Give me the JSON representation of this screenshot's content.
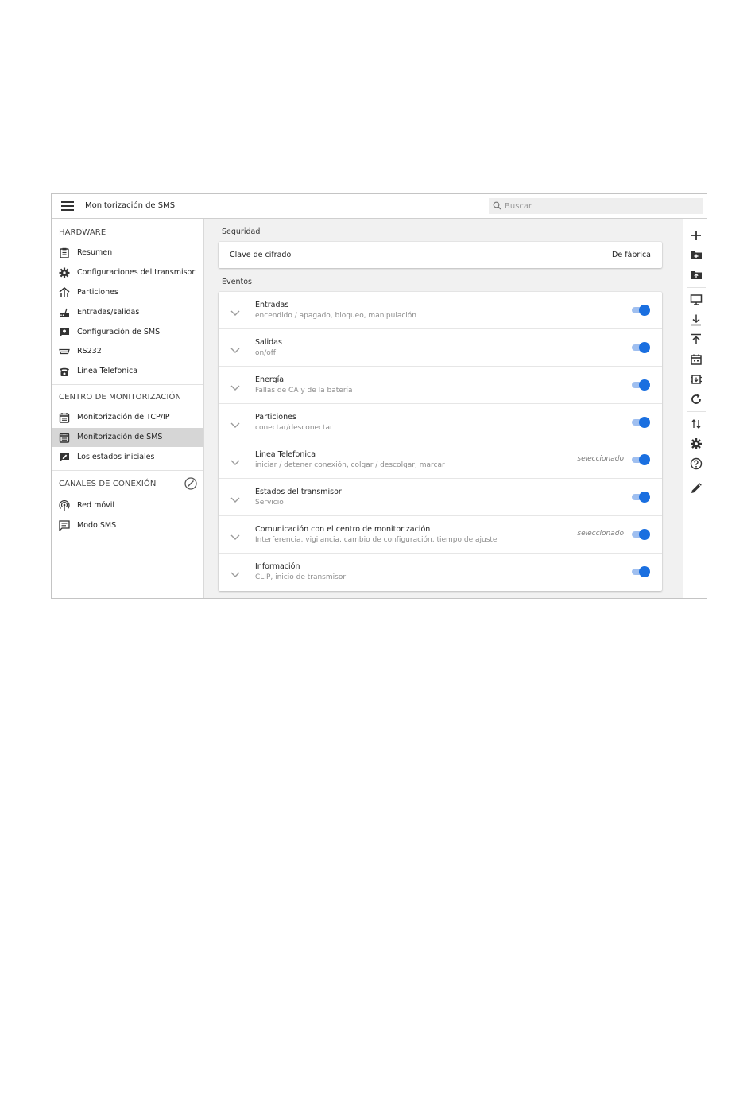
{
  "header": {
    "title": "Monitorización de SMS",
    "search_placeholder": "Buscar"
  },
  "sidebar": {
    "sections": [
      {
        "title": "HARDWARE",
        "items": [
          {
            "label": "Resumen",
            "icon": "clipboard-icon"
          },
          {
            "label": "Configuraciones del transmisor",
            "icon": "gear-icon"
          },
          {
            "label": "Particiones",
            "icon": "partitions-icon"
          },
          {
            "label": "Entradas/salidas",
            "icon": "io-device-icon"
          },
          {
            "label": "Configuración de SMS",
            "icon": "sms-config-icon"
          },
          {
            "label": "RS232",
            "icon": "serial-port-icon"
          },
          {
            "label": "Linea Telefonica",
            "icon": "telephone-icon"
          }
        ]
      },
      {
        "title": "CENTRO DE MONITORIZACIÓN",
        "items": [
          {
            "label": "Monitorización de TCP/IP",
            "icon": "calendar-list-icon"
          },
          {
            "label": "Monitorización de SMS",
            "icon": "calendar-list-icon",
            "active": true
          },
          {
            "label": "Los estados iniciales",
            "icon": "edit-box-icon"
          }
        ]
      },
      {
        "title": "CANALES DE CONEXIÓN",
        "action_icon": "compass-icon",
        "items": [
          {
            "label": "Red móvil",
            "icon": "antenna-icon"
          },
          {
            "label": "Modo SMS",
            "icon": "message-icon"
          }
        ]
      }
    ]
  },
  "security": {
    "title": "Seguridad",
    "key_label": "Clave de cifrado",
    "key_value": "De fábrica"
  },
  "events": {
    "title": "Eventos",
    "items": [
      {
        "title": "Entradas",
        "subtitle": "encendido / apagado, bloqueo, manipulación",
        "selected_text": "",
        "enabled": true
      },
      {
        "title": "Salidas",
        "subtitle": "on/off",
        "selected_text": "",
        "enabled": true
      },
      {
        "title": "Energía",
        "subtitle": "Fallas de CA y de la batería",
        "selected_text": "",
        "enabled": true
      },
      {
        "title": "Particiones",
        "subtitle": "conectar/desconectar",
        "selected_text": "",
        "enabled": true
      },
      {
        "title": "Linea Telefonica",
        "subtitle": "iniciar / detener conexión, colgar / descolgar, marcar",
        "selected_text": "seleccionado",
        "enabled": true
      },
      {
        "title": "Estados del transmisor",
        "subtitle": "Servicio",
        "selected_text": "",
        "enabled": true
      },
      {
        "title": "Comunicación con el centro de monitorización",
        "subtitle": "Interferencia, vigilancia, cambio de configuración, tiempo de ajuste",
        "selected_text": "seleccionado",
        "enabled": true
      },
      {
        "title": "Información",
        "subtitle": "CLIP, inicio de transmisor",
        "selected_text": "",
        "enabled": true
      }
    ]
  },
  "toolbar": {
    "icons": [
      "add-icon",
      "folder-add-icon",
      "folder-upload-icon",
      "monitor-icon",
      "download-icon",
      "upload-icon",
      "calendar-icon",
      "chip-icon",
      "refresh-icon",
      "sort-arrows-icon",
      "gear-icon",
      "help-icon",
      "pencil-icon"
    ]
  },
  "colors": {
    "accent": "#1a6fe0",
    "toggle_track": "#9fbff0",
    "active_item": "#d6d6d6",
    "panel_bg": "#f1f1f1"
  }
}
